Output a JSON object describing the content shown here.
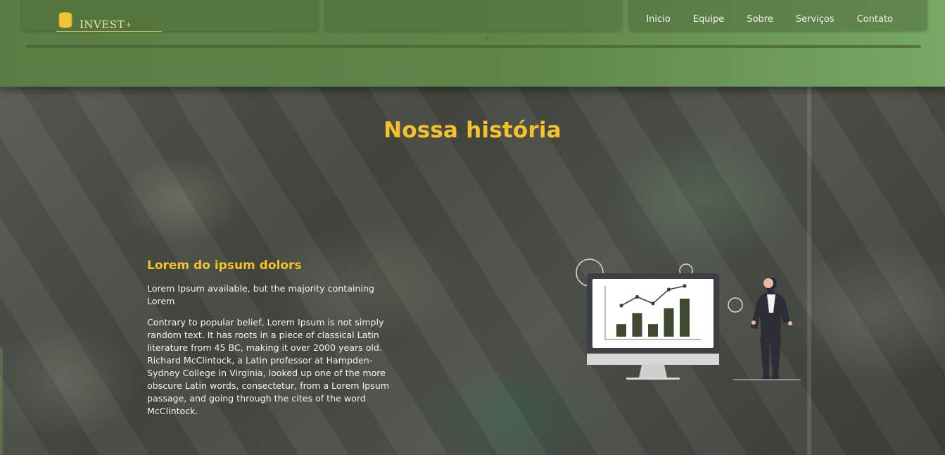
{
  "brand": {
    "name": "INVEST",
    "suffix": "+"
  },
  "nav": {
    "items": [
      {
        "label": "Inicio"
      },
      {
        "label": "Equipe"
      },
      {
        "label": "Sobre"
      },
      {
        "label": "Serviços"
      },
      {
        "label": "Contato"
      }
    ]
  },
  "colors": {
    "accent": "#f5c22b",
    "band": "#5f8549",
    "chart_bar": "#3f4a31",
    "text": "#f4f4f4"
  },
  "hero": {
    "title": "Nossa história",
    "heading": "Lorem do ipsum dolors",
    "intro": "Lorem Ipsum available, but the majority containing Lorem",
    "body": "Contrary to popular belief, Lorem Ipsum is not simply random text. It has roots in a piece of classical Latin literature from 45 BC, making it over 2000 years old. Richard McClintock, a Latin professor at Hampden-Sydney College in Virginia, looked up one of the more obscure Latin words, consectetur, from a Lorem Ipsum passage, and going through the cites of the word McClintock."
  },
  "illustration": {
    "icon": "business-analytics-illustration",
    "monitor_bars": [
      0.33,
      0.62,
      0.33,
      0.75,
      1.0
    ],
    "monitor_points": [
      0.55,
      0.75,
      0.6,
      0.92,
      1.0
    ]
  }
}
